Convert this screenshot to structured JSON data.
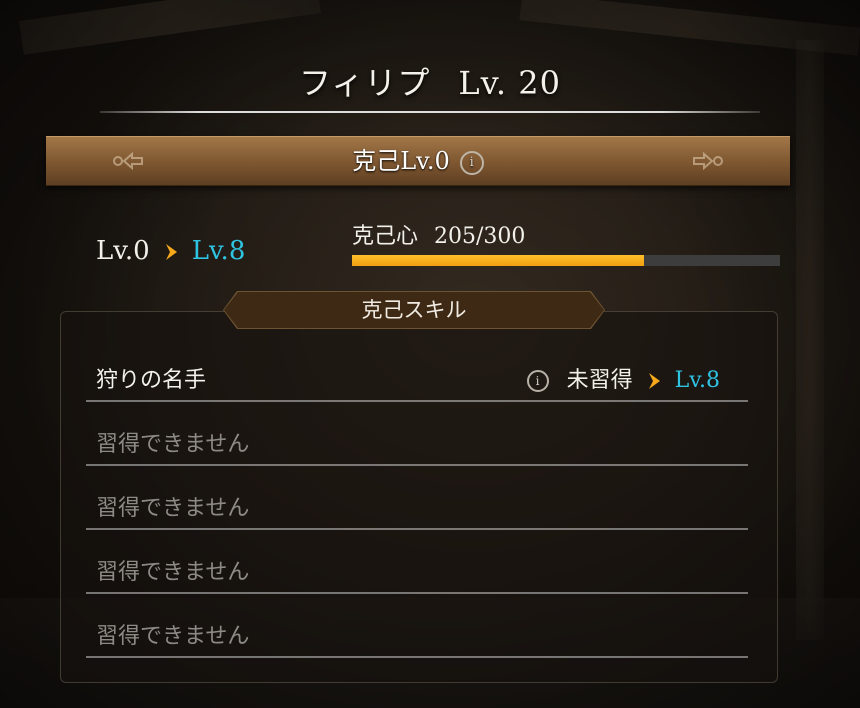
{
  "character": {
    "name": "フィリプ",
    "level_label": "Lv. 20"
  },
  "banner": {
    "title": "克己Lv.0",
    "info_icon_glyph": "i"
  },
  "level_upgrade": {
    "from": "Lv.0",
    "to": "Lv.8"
  },
  "gauge": {
    "label": "克己心",
    "value_text": "205/300",
    "current": 205,
    "max": 300
  },
  "panel": {
    "title": "克己スキル",
    "skills": [
      {
        "name": "狩りの名手",
        "status": "未習得",
        "to_level": "Lv.8",
        "info_icon_glyph": "i"
      },
      {
        "name": "習得できません"
      },
      {
        "name": "習得できません"
      },
      {
        "name": "習得できません"
      },
      {
        "name": "習得できません"
      }
    ]
  },
  "colors": {
    "accent_orange": "#f7a81b",
    "level_cyan": "#2fc3e2",
    "banner_brown": "#7d5630"
  }
}
